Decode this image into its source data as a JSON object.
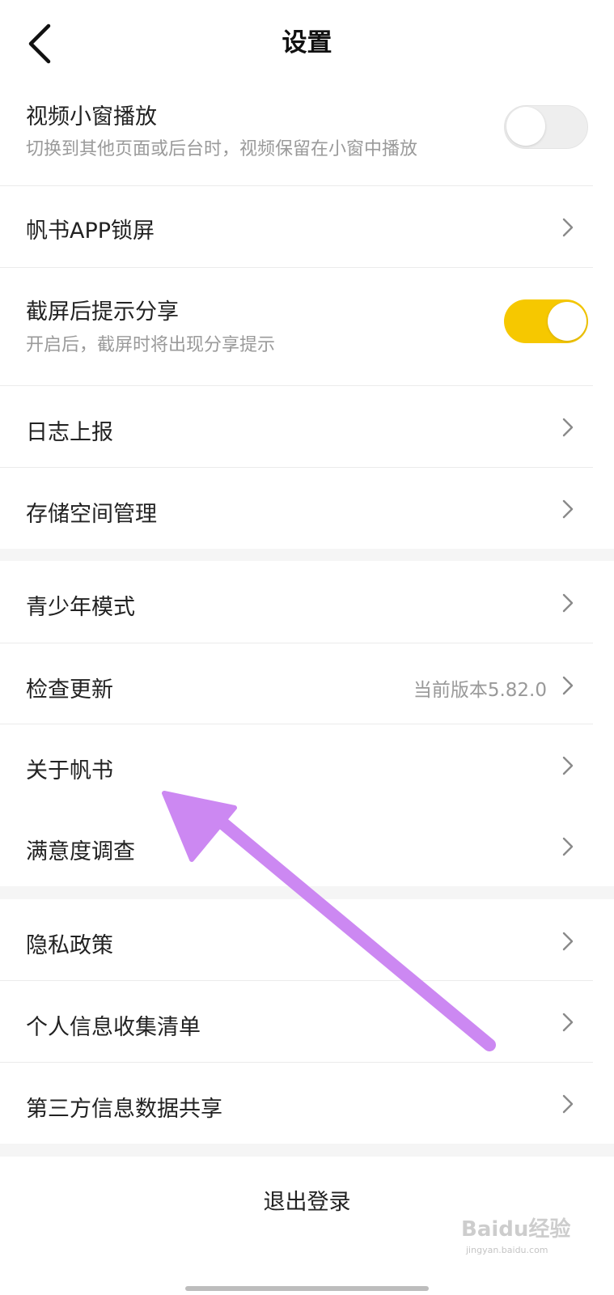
{
  "header": {
    "title": "设置"
  },
  "groups": [
    {
      "rows": [
        {
          "label": "视频小窗播放",
          "sublabel": "切换到其他页面或后台时，视频保留在小窗中播放",
          "control": "toggle",
          "toggle_on": false
        },
        {
          "label": "帆书APP锁屏",
          "control": "chevron"
        },
        {
          "label": "截屏后提示分享",
          "sublabel": "开启后，截屏时将出现分享提示",
          "control": "toggle",
          "toggle_on": true
        },
        {
          "label": "日志上报",
          "control": "chevron"
        },
        {
          "label": "存储空间管理",
          "control": "chevron"
        }
      ]
    },
    {
      "rows": [
        {
          "label": "青少年模式",
          "control": "chevron"
        },
        {
          "label": "检查更新",
          "value": "当前版本5.82.0",
          "control": "chevron"
        },
        {
          "label": "关于帆书",
          "control": "chevron"
        },
        {
          "label": "满意度调查",
          "control": "chevron"
        }
      ]
    },
    {
      "rows": [
        {
          "label": "隐私政策",
          "control": "chevron"
        },
        {
          "label": "个人信息收集清单",
          "control": "chevron"
        },
        {
          "label": "第三方信息数据共享",
          "control": "chevron"
        }
      ]
    }
  ],
  "logout": {
    "label": "退出登录"
  },
  "annotation": {
    "arrow_color": "#cc88f2"
  },
  "watermark": {
    "main": "Baidu经验",
    "sub": "jingyan.baidu.com"
  },
  "colors": {
    "toggle_on": "#f6c800",
    "background": "#f5f5f5"
  }
}
